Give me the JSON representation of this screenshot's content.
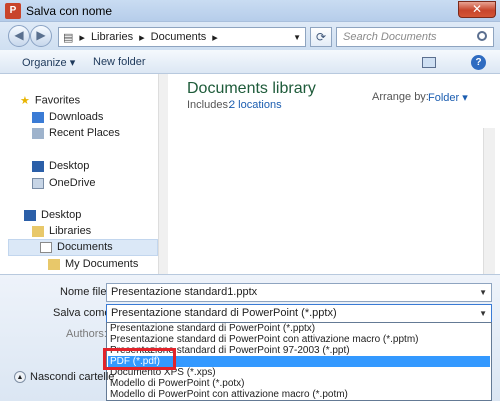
{
  "window": {
    "title": "Salva con nome",
    "close_label": "✕"
  },
  "address": {
    "segments": [
      "Libraries",
      "Documents"
    ],
    "separator": "▸"
  },
  "search": {
    "placeholder": "Search Documents"
  },
  "toolbar": {
    "organize": "Organize ▾",
    "new_folder": "New folder"
  },
  "nav": {
    "favorites": "Favorites",
    "downloads": "Downloads",
    "recent_places": "Recent Places",
    "desktop": "Desktop",
    "onedrive": "OneDrive",
    "desktop2": "Desktop",
    "libraries": "Libraries",
    "documents": "Documents",
    "my_documents": "My Documents"
  },
  "library": {
    "title": "Documents library",
    "includes_label": "Includes:",
    "locations_link": "2 locations",
    "arrange_label": "Arrange by:",
    "arrange_value": "Folder ▾"
  },
  "form": {
    "filename_label": "Nome file:",
    "filename_value": "Presentazione standard1.pptx",
    "saveas_label": "Salva come:",
    "saveas_value": "Presentazione standard di PowerPoint (*.pptx)",
    "authors_label": "Authors:",
    "hide_folders": "Nascondi cartelle"
  },
  "dropdown": {
    "options": [
      "Presentazione standard di PowerPoint (*.pptx)",
      "Presentazione standard di PowerPoint con attivazione macro (*.pptm)",
      "Presentazione standard di PowerPoint 97-2003 (*.ppt)",
      "PDF (*.pdf)",
      "Documento XPS (*.xps)",
      "Modello di PowerPoint (*.potx)",
      "Modello di PowerPoint con attivazione macro (*.potm)"
    ],
    "selected_index": 3
  },
  "colors": {
    "accent": "#3399ff",
    "highlight_border": "#e2232a",
    "library_title": "#1e5b3a"
  }
}
